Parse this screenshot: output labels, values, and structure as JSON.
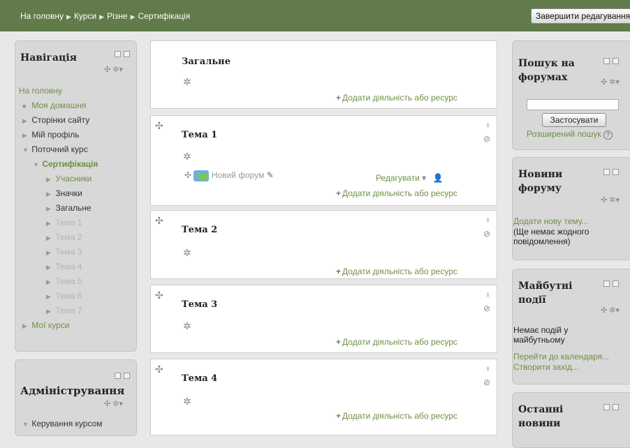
{
  "breadcrumb": [
    "На головну",
    "Курси",
    "Різне",
    "Сертифікація"
  ],
  "edit_button": "Завершити редагування",
  "navigation": {
    "title": "Навігація",
    "home": "На головну",
    "items": {
      "my_home": "Моя домашня",
      "site_pages": "Сторінки сайту",
      "my_profile": "Мій профіль",
      "current_course": "Поточний курс",
      "course": "Сертифікація",
      "participants": "Учасники",
      "badges": "Значки",
      "general": "Загальне",
      "topic1": "Тема 1",
      "topic2": "Тема 2",
      "topic3": "Тема 3",
      "topic4": "Тема 4",
      "topic5": "Тема 5",
      "topic6": "Тема 6",
      "topic7": "Тема 7",
      "my_courses": "Мої курси"
    }
  },
  "admin": {
    "title": "Адміністрування",
    "item": "Керування курсом"
  },
  "sections": {
    "general": "Загальне",
    "topic1": "Тема 1",
    "topic2": "Тема 2",
    "topic3": "Тема 3",
    "topic4": "Тема 4",
    "add_activity": "Додати діяльність або ресурс",
    "forum_name": "Новий форум",
    "edit_label": "Редагувати"
  },
  "search_forums": {
    "title": "Пошук на форумах",
    "apply": "Застосувати",
    "advanced": "Розширений пошук"
  },
  "news": {
    "title": "Новини форуму",
    "add_topic": "Додати нову тему...",
    "empty": "(Ще немає жодного повідомлення)"
  },
  "upcoming": {
    "title": "Майбутні події",
    "none": "Немає подій у майбутньому",
    "go_calendar": "Перейти до календаря...",
    "create_event": "Створити захід..."
  },
  "recent": {
    "title": "Останні новини"
  },
  "colors": {
    "topbar": "#617b4a",
    "link": "#6f8f46"
  }
}
